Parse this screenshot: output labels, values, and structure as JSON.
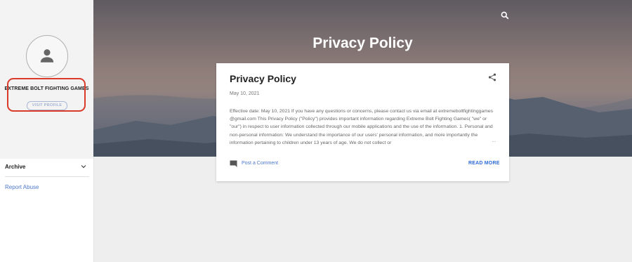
{
  "profile": {
    "name": "EXTREME BOLT FIGHTING GAMES",
    "visit_label": "VISIT PROFILE"
  },
  "sidebar": {
    "archive_label": "Archive",
    "report_abuse_label": "Report Abuse"
  },
  "header": {
    "title": "Privacy Policy"
  },
  "post": {
    "title": "Privacy Policy",
    "date": "May 10, 2021",
    "snippet": "Effective date: May 10, 2021 If you have any questions or concerns, please contact us via email at extremeboltfightinggames @gmail.com This Privacy Policy (\"Policy\") provides important information regarding Extreme Bolt Fighting Games( \"we\" or \"our\") in respect to user information collected through our mobile applications and the use of the information. 1. Personal and non-personal information: We understand the importance of our users' personal information, and more importantly the information pertaining to children under 13 years of age. We do not collect or",
    "ellipsis": "…",
    "comment_label": "Post a Comment",
    "read_more_label": "READ MORE"
  },
  "icons": {
    "avatar": "person-icon",
    "search": "search-icon",
    "share": "share-icon",
    "comment": "comment-icon",
    "archive_toggle": "chevron-down-icon"
  },
  "colors": {
    "highlight": "#d93a2a",
    "link": "#4d79c9",
    "read_more": "#2f6bd6"
  }
}
